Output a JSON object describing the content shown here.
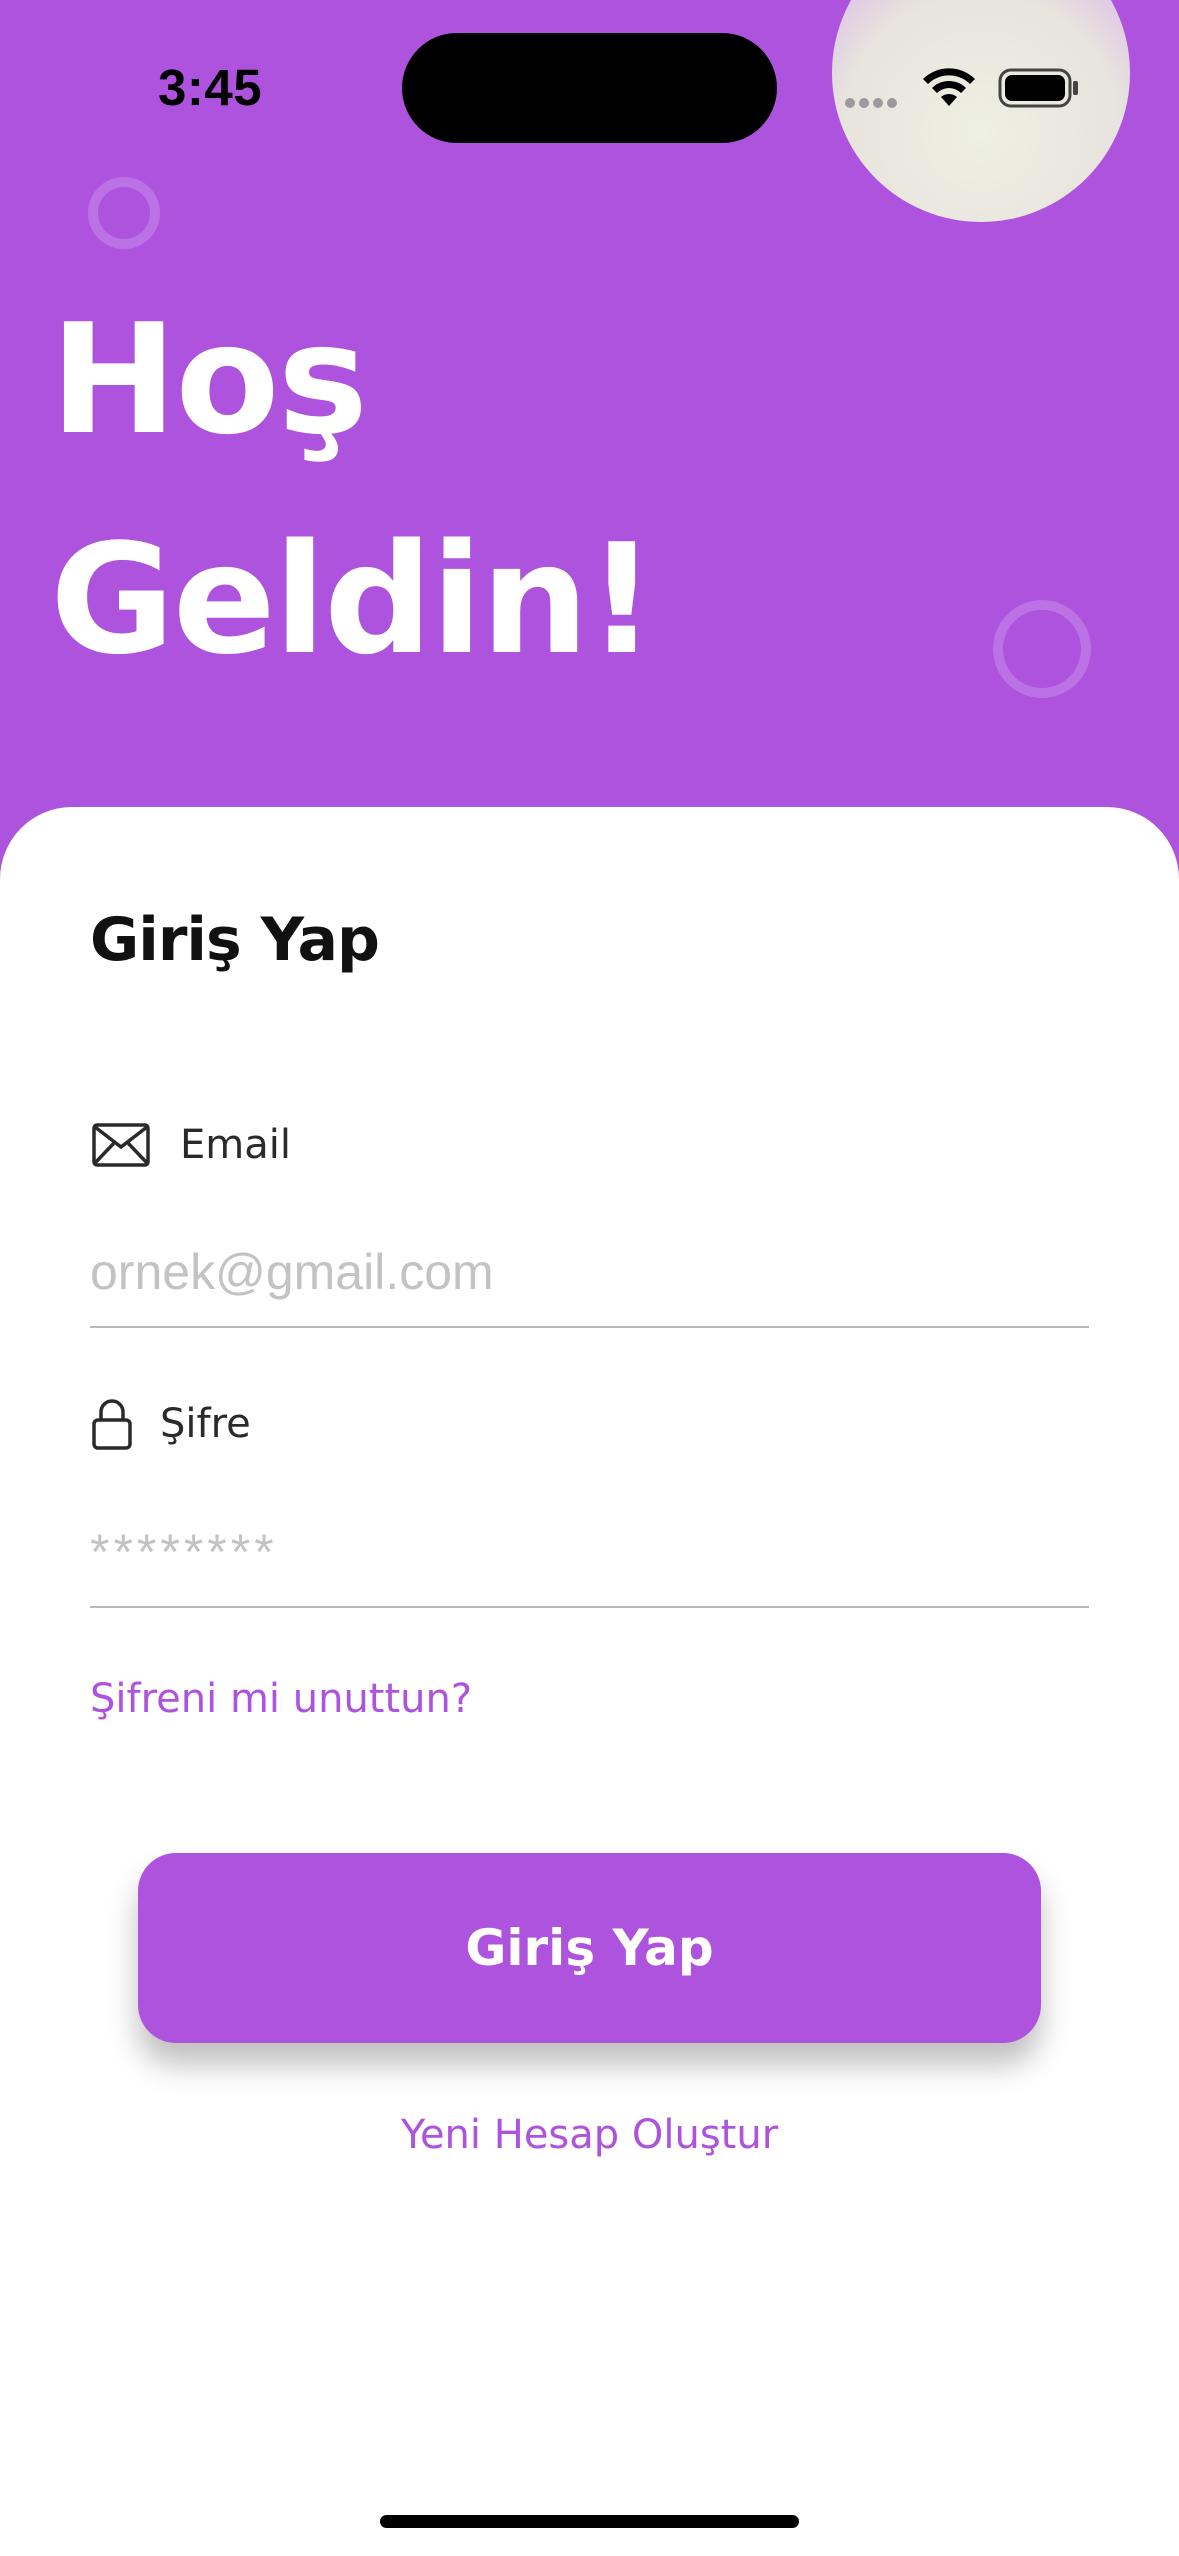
{
  "status_bar": {
    "time": "3:45"
  },
  "hero": {
    "title_line1": "Hoş",
    "title_line2": "Geldin!"
  },
  "form": {
    "title": "Giriş Yap",
    "email": {
      "label": "Email",
      "placeholder": "ornek@gmail.com",
      "icon": "envelope-icon"
    },
    "password": {
      "label": "Şifre",
      "placeholder": "********",
      "icon": "lock-icon"
    },
    "forgot_label": "Şifreni mi unuttun?",
    "login_label": "Giriş Yap",
    "create_account_label": "Yeni Hesap Oluştur"
  },
  "colors": {
    "accent": "#ad53de",
    "background": "#ffffff"
  }
}
